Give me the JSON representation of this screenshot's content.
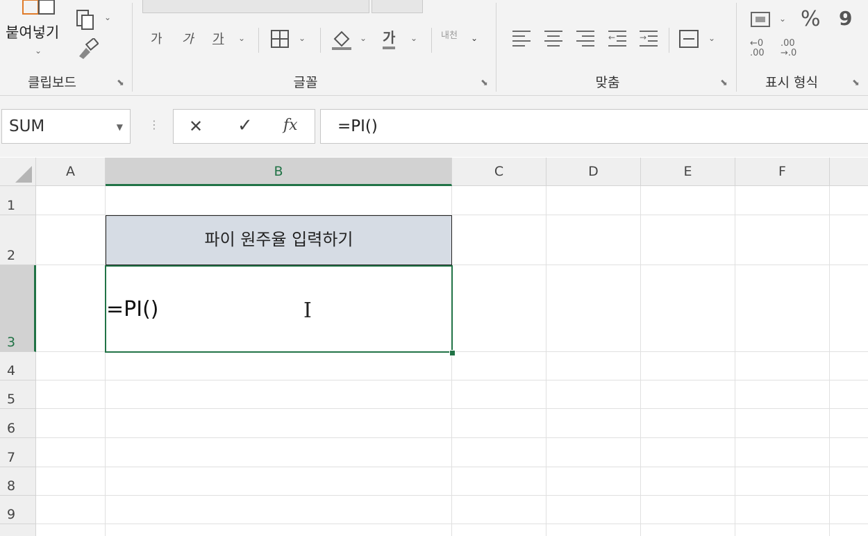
{
  "ribbon": {
    "clipboard": {
      "paste_label": "붙여넣기",
      "group_label": "클립보드"
    },
    "font": {
      "group_label": "글꼴",
      "grow_font": "가",
      "shrink_font": "가",
      "underline_font": "가",
      "font_color_glyph": "가",
      "phonetic_label": "내천"
    },
    "alignment": {
      "group_label": "맞춤"
    },
    "number": {
      "group_label": "표시 형식",
      "percent": "%",
      "comma": "9"
    }
  },
  "formula_bar": {
    "name_box": "SUM",
    "cancel_glyph": "✕",
    "enter_glyph": "✓",
    "fx_label": "fx",
    "formula": "=PI()"
  },
  "grid": {
    "columns": [
      "A",
      "B",
      "C",
      "D",
      "E",
      "F"
    ],
    "rows": [
      "1",
      "2",
      "3",
      "4",
      "5",
      "6",
      "7",
      "8",
      "9"
    ],
    "cell_b2": "파이 원주율 입력하기",
    "cell_b3_edit": "=PI()",
    "header_fill": "#d6dce4",
    "selection_color": "#217346"
  }
}
